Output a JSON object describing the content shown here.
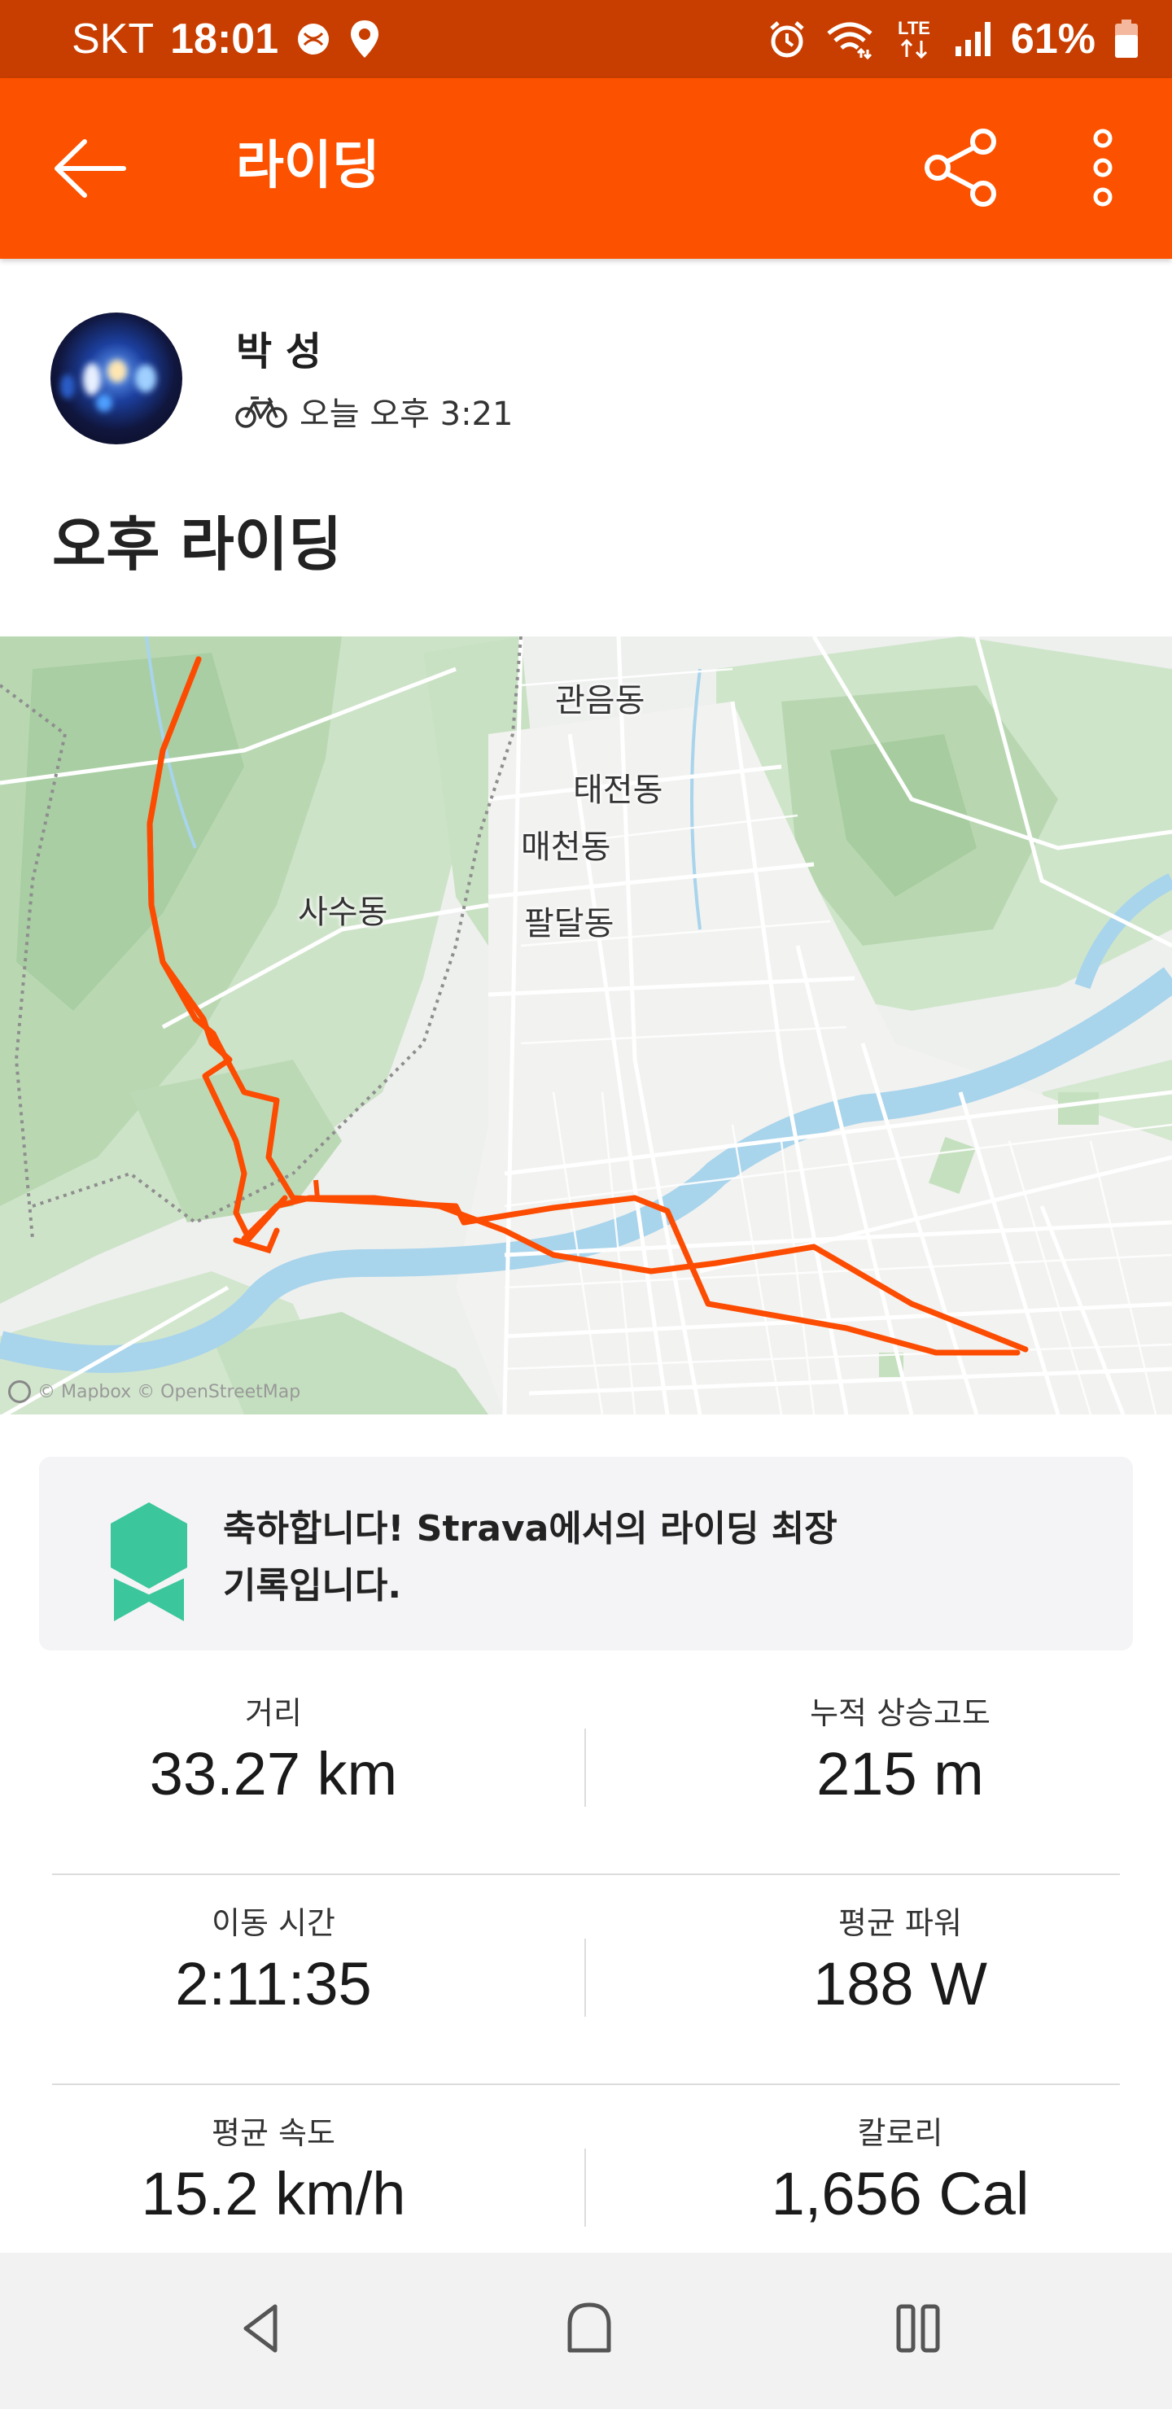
{
  "status_bar": {
    "carrier": "SKT",
    "time": "18:01",
    "network": "LTE",
    "battery_percent": "61%",
    "icons": [
      "browser-icon",
      "location-icon",
      "alarm-icon",
      "wifi-icon",
      "lte-icon",
      "signal-icon",
      "battery-icon"
    ]
  },
  "app_bar": {
    "title": "라이딩",
    "icons": [
      "back-arrow-icon",
      "share-icon",
      "more-vert-icon"
    ],
    "color": "#fc5200"
  },
  "athlete": {
    "name": "박 성",
    "timestamp": "오늘 오후 3:21",
    "activity_icon": "bike-icon"
  },
  "activity": {
    "title": "오후 라이딩"
  },
  "map": {
    "labels": [
      "관음동",
      "태전동",
      "매천동",
      "사수동",
      "팔달동"
    ],
    "attribution": "© Mapbox © OpenStreetMap",
    "route_color": "#fc4c02",
    "water_color": "#a8d4ec"
  },
  "achievement": {
    "icon": "medal-icon",
    "line1": "축하합니다! Strava에서의 라이딩 최장",
    "line2": "기록입니다.",
    "medal_color": "#3cc69b"
  },
  "stats": {
    "distance": {
      "label": "거리",
      "value": "33.27 km"
    },
    "elevation": {
      "label": "누적 상승고도",
      "value": "215 m"
    },
    "moving_time": {
      "label": "이동 시간",
      "value": "2:11:35"
    },
    "avg_power": {
      "label": "평균 파워",
      "value": "188 W"
    },
    "avg_speed": {
      "label": "평균 속도",
      "value": "15.2 km/h"
    },
    "calories": {
      "label": "칼로리",
      "value": "1,656 Cal"
    }
  },
  "nav_bar": {
    "icons": [
      "nav-back-icon",
      "nav-home-icon",
      "nav-recents-icon"
    ]
  }
}
